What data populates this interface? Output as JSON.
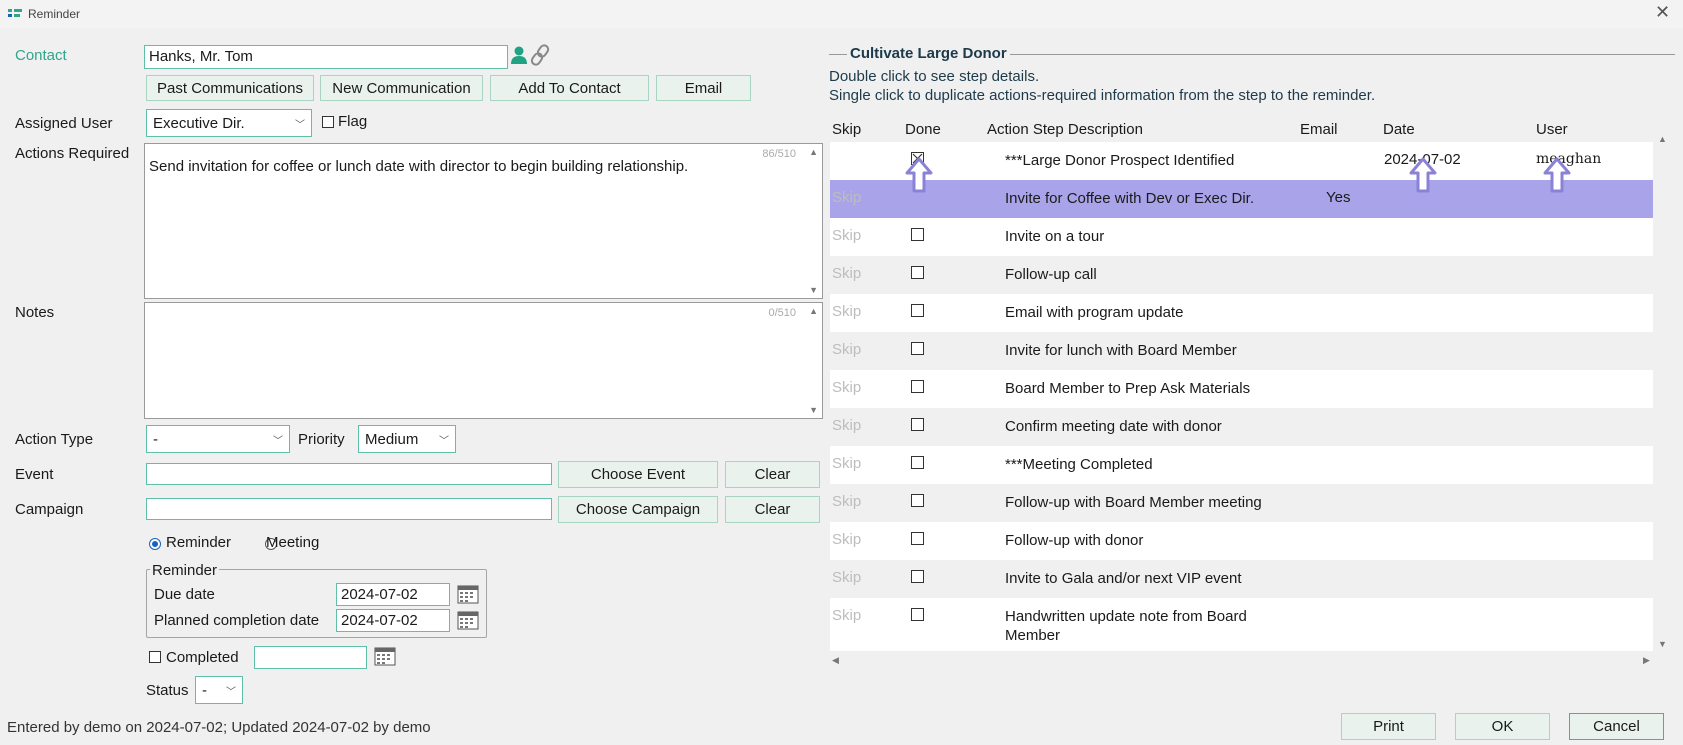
{
  "window": {
    "title": "Reminder"
  },
  "form": {
    "contact_label": "Contact",
    "contact_value": "Hanks, Mr. Tom",
    "buttons": {
      "past": "Past Communications",
      "new": "New Communication",
      "add": "Add To Contact",
      "email": "Email"
    },
    "assigned_user_label": "Assigned User",
    "assigned_user_value": "Executive Dir.",
    "flag_label": "Flag",
    "actions_required_label": "Actions Required",
    "actions_required_text": "Send invitation for coffee or lunch date with director to begin building relationship.",
    "actions_counter": "86/510",
    "notes_label": "Notes",
    "notes_text": "",
    "notes_counter": "0/510",
    "action_type_label": "Action Type",
    "action_type_value": "-",
    "priority_label": "Priority",
    "priority_value": "Medium",
    "event_label": "Event",
    "event_value": "",
    "choose_event": "Choose Event",
    "clear_event": "Clear",
    "campaign_label": "Campaign",
    "campaign_value": "",
    "choose_campaign": "Choose Campaign",
    "clear_campaign": "Clear",
    "radio_reminder": "Reminder",
    "radio_meeting": "Meeting",
    "reminder_group_title": "Reminder",
    "due_date_label": "Due date",
    "due_date_value": "2024-07-02",
    "planned_label": "Planned completion date",
    "planned_value": "2024-07-02",
    "completed_label": "Completed",
    "completed_value": "",
    "status_label": "Status",
    "status_value": "-"
  },
  "footer": {
    "entered_text": "Entered by demo on 2024-07-02; Updated 2024-07-02 by demo",
    "print": "Print",
    "ok": "OK",
    "cancel": "Cancel"
  },
  "workflow": {
    "title": "Cultivate Large Donor",
    "hint1": "Double click to see step details.",
    "hint2": "Single click to duplicate actions-required information from the step to the reminder.",
    "columns": {
      "skip": "Skip",
      "done": "Done",
      "desc": "Action Step Description",
      "email": "Email",
      "date": "Date",
      "user": "User"
    },
    "rows": [
      {
        "skip": "",
        "done": true,
        "desc": "***Large Donor Prospect Identified",
        "email": "",
        "date": "2024-07-02",
        "user": "meaghan"
      },
      {
        "skip": "Skip",
        "done": false,
        "desc": "Invite for Coffee with Dev or Exec Dir.",
        "email": "Yes",
        "date": "",
        "user": "",
        "selected": true
      },
      {
        "skip": "Skip",
        "done": false,
        "desc": "Invite on a tour",
        "email": "",
        "date": "",
        "user": ""
      },
      {
        "skip": "Skip",
        "done": false,
        "desc": "Follow-up call",
        "email": "",
        "date": "",
        "user": ""
      },
      {
        "skip": "Skip",
        "done": false,
        "desc": "Email with program update",
        "email": "",
        "date": "",
        "user": ""
      },
      {
        "skip": "Skip",
        "done": false,
        "desc": "Invite for lunch with Board Member",
        "email": "",
        "date": "",
        "user": ""
      },
      {
        "skip": "Skip",
        "done": false,
        "desc": "Board Member to Prep Ask Materials",
        "email": "",
        "date": "",
        "user": ""
      },
      {
        "skip": "Skip",
        "done": false,
        "desc": "Confirm meeting date with donor",
        "email": "",
        "date": "",
        "user": ""
      },
      {
        "skip": "Skip",
        "done": false,
        "desc": "***Meeting Completed",
        "email": "",
        "date": "",
        "user": ""
      },
      {
        "skip": "Skip",
        "done": false,
        "desc": "Follow-up with Board Member meeting",
        "email": "",
        "date": "",
        "user": ""
      },
      {
        "skip": "Skip",
        "done": false,
        "desc": "Follow-up with donor",
        "email": "",
        "date": "",
        "user": ""
      },
      {
        "skip": "Skip",
        "done": false,
        "desc": "Invite to Gala and/or next VIP event",
        "email": "",
        "date": "",
        "user": ""
      },
      {
        "skip": "Skip",
        "done": false,
        "desc": "Handwritten update note from Board Member",
        "email": "",
        "date": "",
        "user": ""
      }
    ]
  }
}
